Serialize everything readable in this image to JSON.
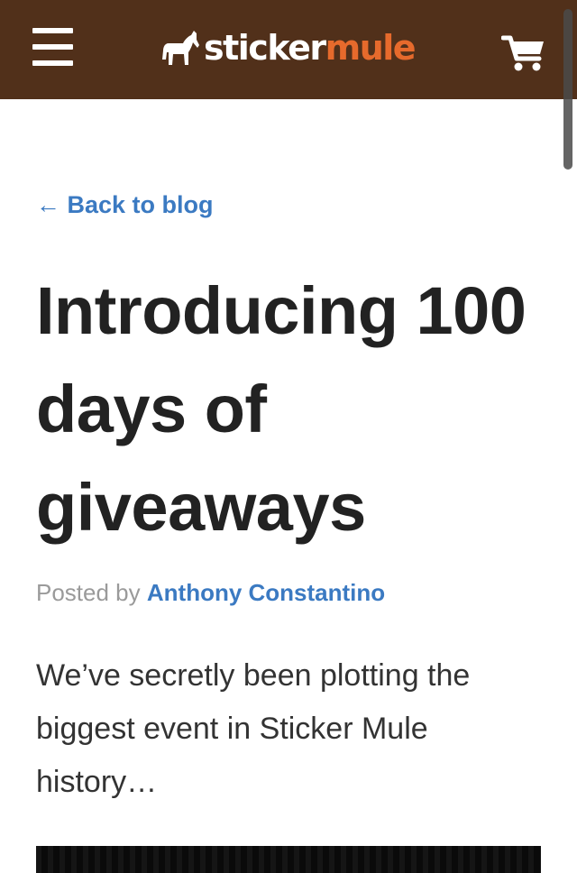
{
  "header": {
    "menu_icon": "hamburger-menu-icon",
    "logo": {
      "word1": "sticker",
      "word2": "mule",
      "icon": "mule-icon"
    },
    "cart_icon": "shopping-cart-icon",
    "colors": {
      "background": "#51301a",
      "logo_accent": "#e66a2c"
    }
  },
  "article": {
    "back_link": "← Back to blog",
    "title": "Introducing 100 days of giveaways",
    "byline_prefix": "Posted by",
    "author": "Anthony Constantino",
    "intro": "We’ve secretly been plotting the biggest event in Sticker Mule history…"
  },
  "colors": {
    "link": "#3b7ac2",
    "title": "#222222",
    "body": "#333333",
    "meta": "#9a9a9a"
  }
}
